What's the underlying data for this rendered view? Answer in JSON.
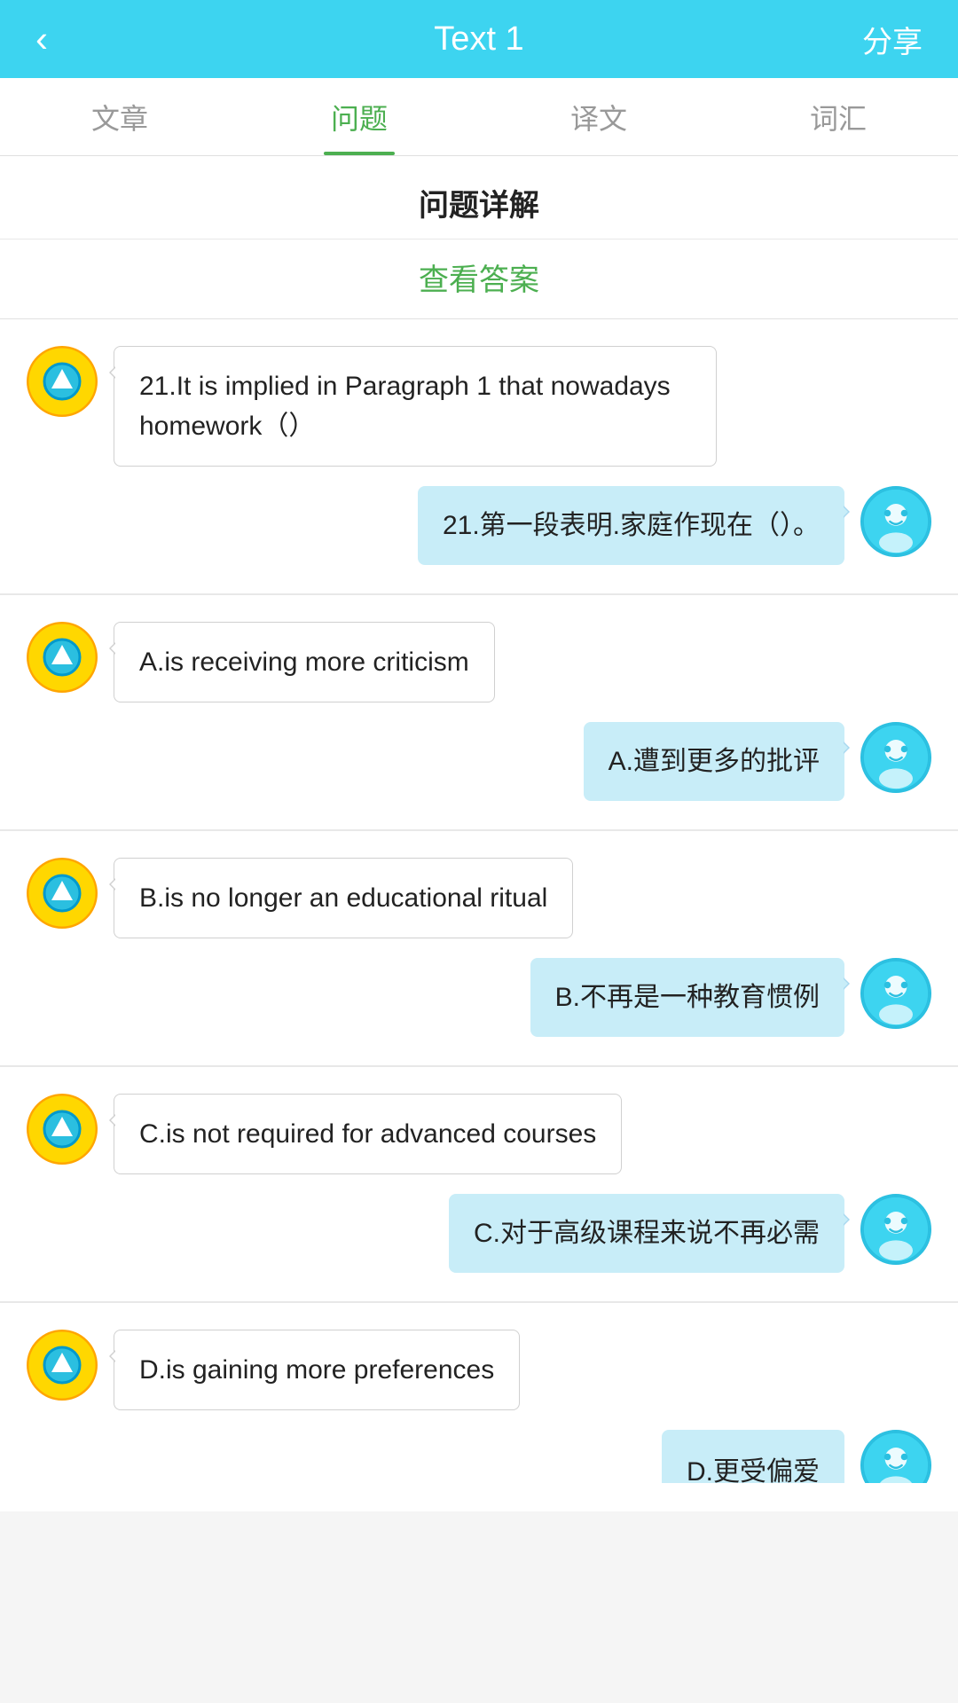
{
  "header": {
    "back_label": "‹",
    "title": "Text 1",
    "share_label": "分享"
  },
  "tabs": [
    {
      "id": "article",
      "label": "文章",
      "active": false
    },
    {
      "id": "question",
      "label": "问题",
      "active": true
    },
    {
      "id": "translation",
      "label": "译文",
      "active": false
    },
    {
      "id": "vocabulary",
      "label": "词汇",
      "active": false
    }
  ],
  "section_title": "问题详解",
  "view_answer_label": "查看答案",
  "chat_items": [
    {
      "id": "q21-en",
      "side": "left",
      "text": "21.It is implied in Paragraph 1 that nowadays homework（）"
    },
    {
      "id": "q21-zh",
      "side": "right",
      "text": "21.第一段表明.家庭作现在（）。"
    },
    {
      "id": "optA-en",
      "side": "left",
      "text": "A.is receiving more criticism"
    },
    {
      "id": "optA-zh",
      "side": "right",
      "text": "A.遭到更多的批评"
    },
    {
      "id": "optB-en",
      "side": "left",
      "text": "B.is no longer an educational ritual"
    },
    {
      "id": "optB-zh",
      "side": "right",
      "text": "B.不再是一种教育惯例"
    },
    {
      "id": "optC-en",
      "side": "left",
      "text": "C.is not required for advanced courses"
    },
    {
      "id": "optC-zh",
      "side": "right",
      "text": "C.对于高级课程来说不再必需"
    },
    {
      "id": "optD-en",
      "side": "left",
      "text": "D.is gaining more preferences"
    },
    {
      "id": "optD-zh",
      "side": "right",
      "text": "D.更受偏爱",
      "partial": true
    }
  ]
}
